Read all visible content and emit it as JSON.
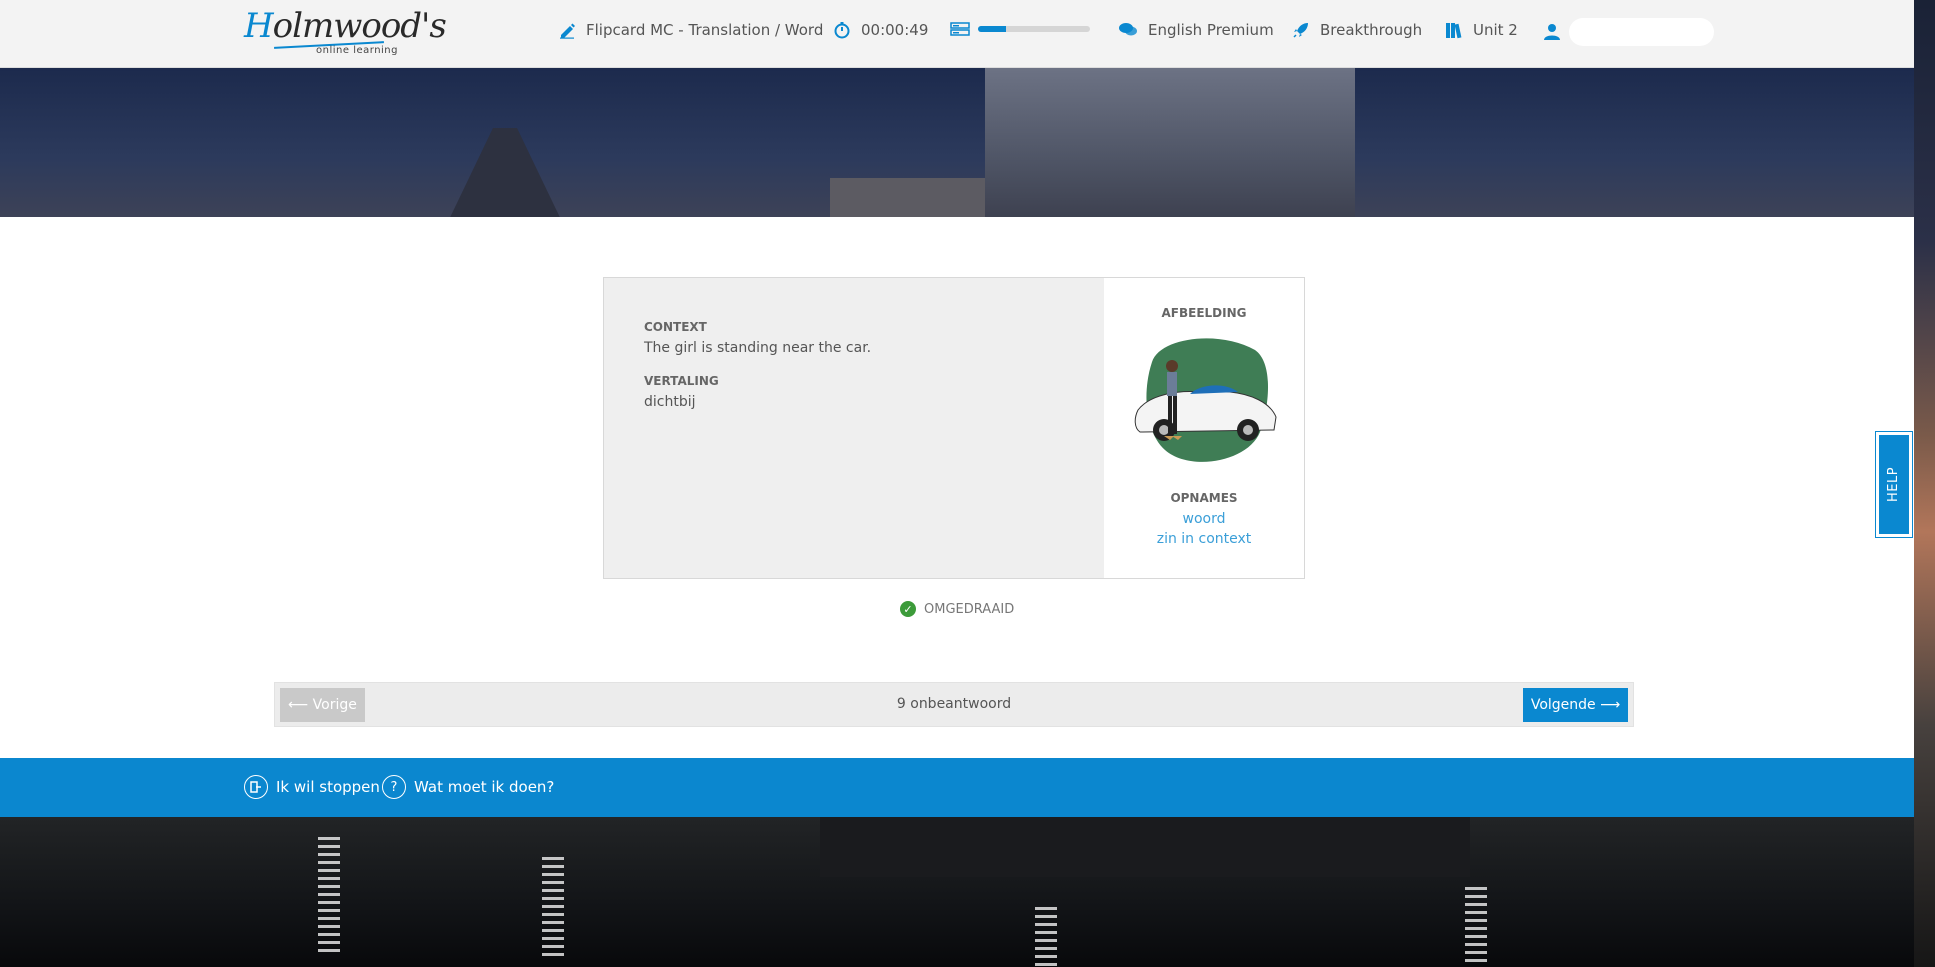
{
  "brand": {
    "logo_text": "Holmwood's",
    "logo_sub": "online learning",
    "accent": "#0a88d0"
  },
  "topbar": {
    "exercise": "Flipcard MC - Translation / Word",
    "timer": "00:00:49",
    "progress_percent": 25,
    "course": "English Premium",
    "level": "Breakthrough",
    "unit": "Unit 2"
  },
  "card": {
    "context_label": "CONTEXT",
    "context_value": "The girl is standing near the car.",
    "translation_label": "VERTALING",
    "translation_value": "dichtbij",
    "image_label": "AFBEELDING",
    "recordings_label": "OPNAMES",
    "recording_word": "woord",
    "recording_context": "zin in context"
  },
  "status": {
    "label": "OMGEDRAAID",
    "color": "#3c9b3a"
  },
  "pager": {
    "prev_label": "⟵ Vorige",
    "unanswered": "9 onbeantwoord",
    "next_label": "Volgende ⟶"
  },
  "footer": {
    "stop_label": "Ik wil stoppen",
    "help_label": "Wat moet ik doen?"
  },
  "help_tab": {
    "label": "HELP"
  }
}
